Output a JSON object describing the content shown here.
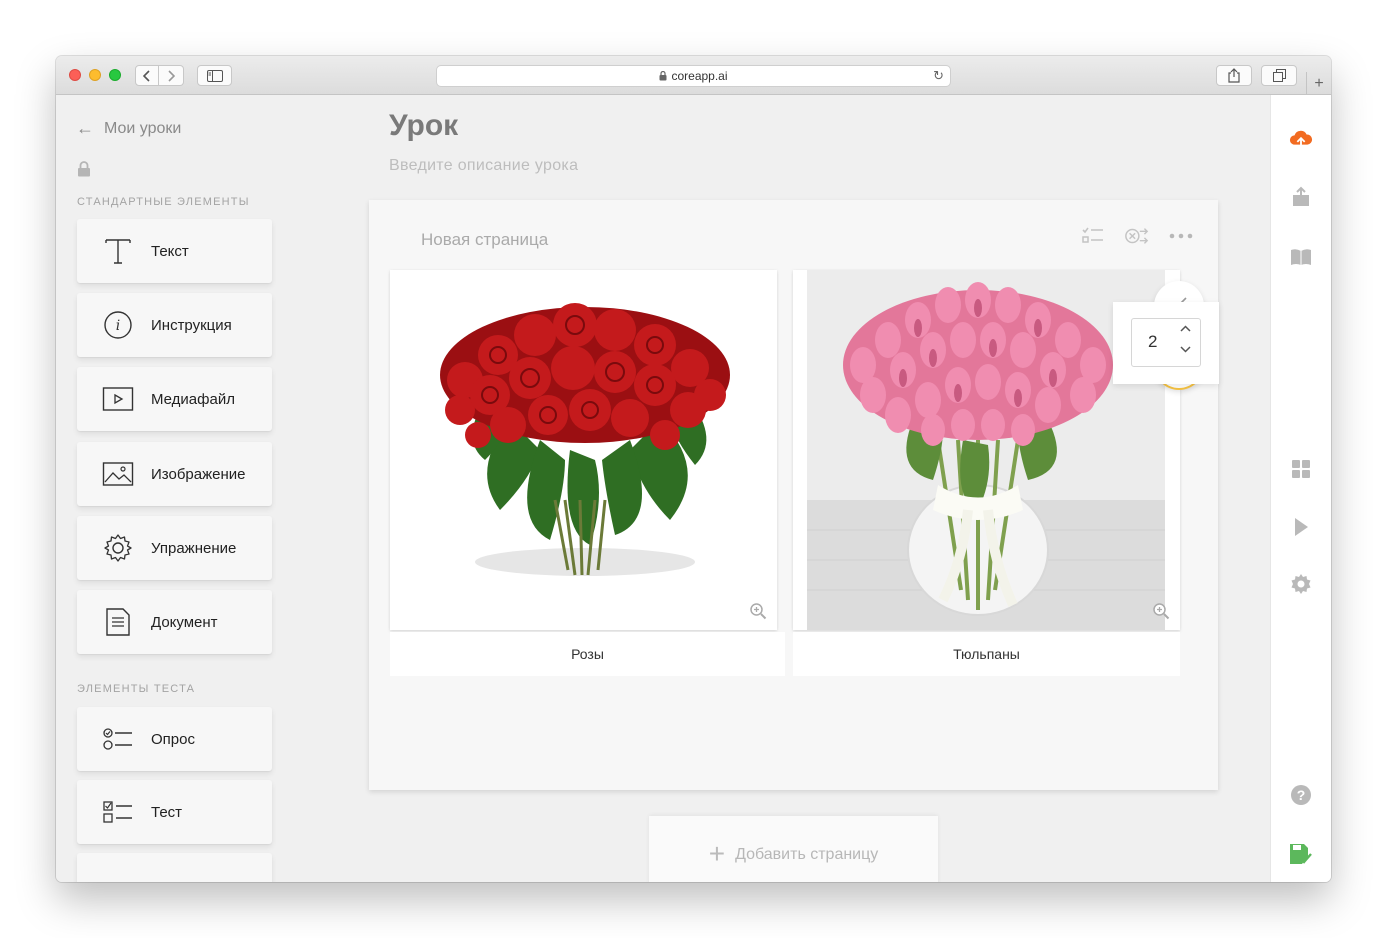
{
  "browser": {
    "address": "coreapp.ai"
  },
  "sidebar": {
    "back_label": "Мои уроки",
    "standard_title": "СТАНДАРТНЫЕ ЭЛЕМЕНТЫ",
    "standard_items": [
      {
        "label": "Текст",
        "icon": "text-icon"
      },
      {
        "label": "Инструкция",
        "icon": "info-icon"
      },
      {
        "label": "Медиафайл",
        "icon": "media-icon"
      },
      {
        "label": "Изображение",
        "icon": "image-icon"
      },
      {
        "label": "Упражнение",
        "icon": "gear-icon"
      },
      {
        "label": "Документ",
        "icon": "document-icon"
      }
    ],
    "test_title": "ЭЛЕМЕНТЫ ТЕСТА",
    "test_items": [
      {
        "label": "Опрос",
        "icon": "poll-icon"
      },
      {
        "label": "Тест",
        "icon": "test-icon"
      }
    ]
  },
  "lesson": {
    "title": "Урок",
    "description_placeholder": "Введите описание урока"
  },
  "page": {
    "name": "Новая страница",
    "images": [
      {
        "caption": "Розы"
      },
      {
        "caption": "Тюльпаны"
      }
    ],
    "columns_value": "2"
  },
  "add_page_label": "Добавить страницу",
  "colors": {
    "accent_orange": "#f26b21",
    "accent_yellow": "#f5c242",
    "save_green": "#5cb85c",
    "rail_icon": "#b9b9b9"
  }
}
